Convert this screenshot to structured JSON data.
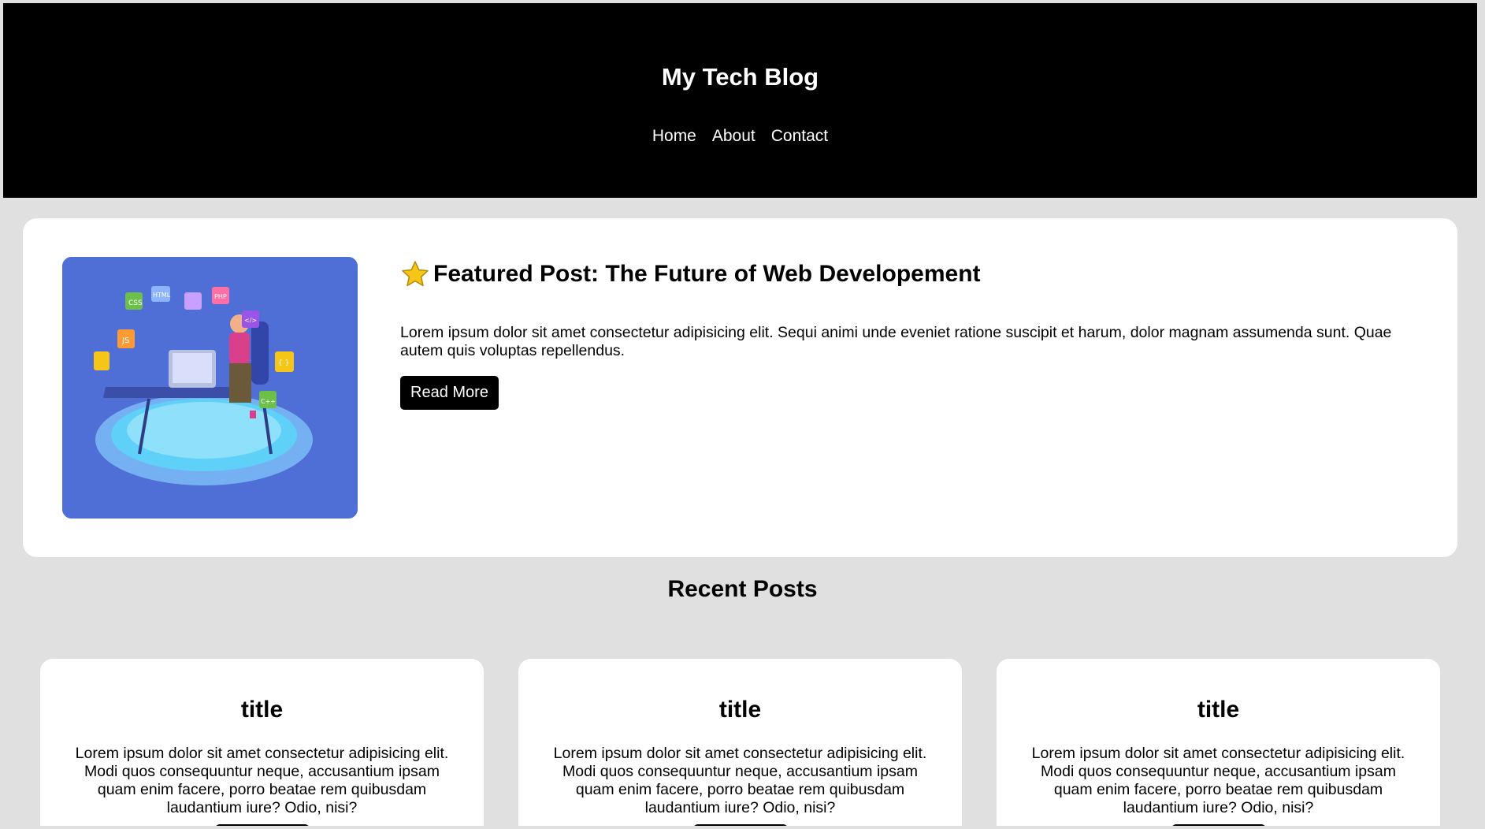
{
  "header": {
    "title": "My Tech Blog",
    "nav": [
      "Home",
      "About",
      "Contact"
    ]
  },
  "featured": {
    "title": "Featured Post: The Future of Web Developement",
    "star_icon": "star-icon",
    "text": "Lorem ipsum dolor sit amet consectetur adipisicing elit. Sequi animi unde eveniet ratione suscipit et harum, dolor magnam assumenda sunt. Quae autem quis voluptas repellendus.",
    "button_label": "Read More",
    "image": {
      "icon_labels": [
        "CSS",
        "HTML",
        "PHP",
        "JS",
        "C++",
        "</>",
        "{ }"
      ]
    }
  },
  "recent": {
    "heading": "Recent Posts",
    "posts": [
      {
        "title": "title",
        "text": "Lorem ipsum dolor sit amet consectetur adipisicing elit. Modi quos consequuntur neque, accusantium ipsam quam enim facere, porro beatae rem quibusdam laudantium iure? Odio, nisi?"
      },
      {
        "title": "title",
        "text": "Lorem ipsum dolor sit amet consectetur adipisicing elit. Modi quos consequuntur neque, accusantium ipsam quam enim facere, porro beatae rem quibusdam laudantium iure? Odio, nisi?"
      },
      {
        "title": "title",
        "text": "Lorem ipsum dolor sit amet consectetur adipisicing elit. Modi quos consequuntur neque, accusantium ipsam quam enim facere, porro beatae rem quibusdam laudantium iure? Odio, nisi?"
      }
    ]
  },
  "colors": {
    "page_bg": "#e0e0e0",
    "header_bg": "#000000",
    "card_bg": "#ffffff",
    "button_bg": "#000000",
    "image_bg": "#4f6fd6",
    "star": "#f5c518"
  }
}
